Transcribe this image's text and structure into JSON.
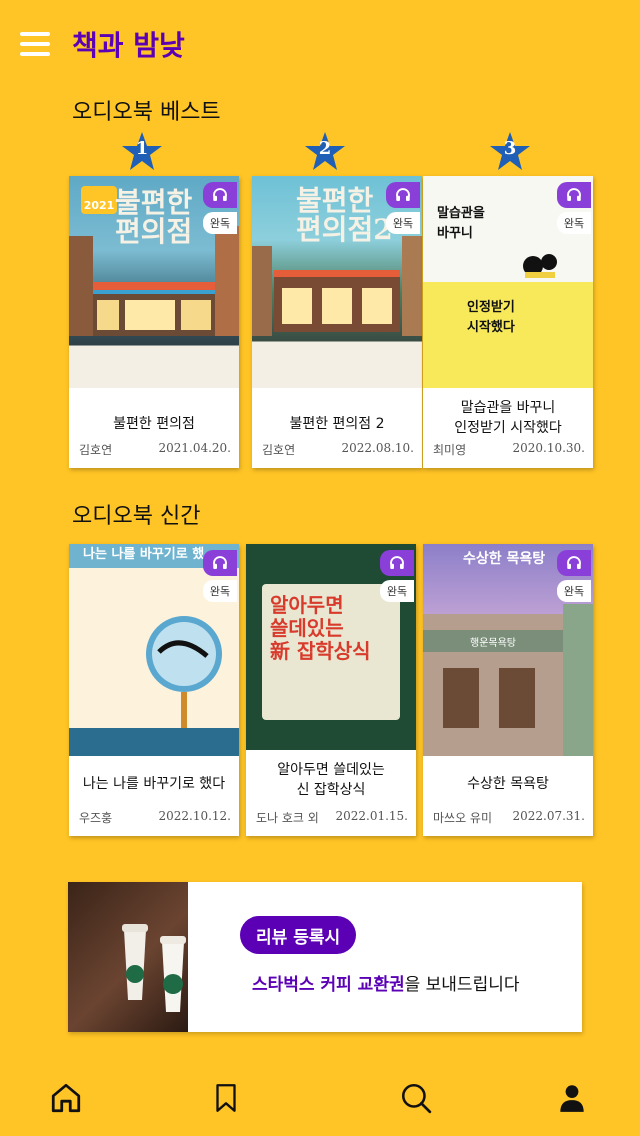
{
  "app": {
    "title": "책과 밤낮"
  },
  "sections": {
    "best": {
      "title": "오디오북 베스트"
    },
    "new": {
      "title": "오디오북 신간"
    }
  },
  "badges": {
    "done": "완독"
  },
  "best_books": [
    {
      "rank": "1",
      "title": "불편한 편의점",
      "author": "김호연",
      "date": "2021.04.20.",
      "cover_title": "불편한\n편의점",
      "cover_badge": "2021"
    },
    {
      "rank": "2",
      "title": "불편한 편의점 2",
      "author": "김호연",
      "date": "2022.08.10.",
      "cover_title": "불편한\n편의점2"
    },
    {
      "rank": "3",
      "title": "말습관을 바꾸니\n인정받기 시작했다",
      "author": "최미영",
      "date": "2020.10.30.",
      "cover_title_top": "말습관을\n바꾸니",
      "cover_title_bottom": "인정받기\n시작했다"
    }
  ],
  "new_books": [
    {
      "title": "나는 나를 바꾸기로 했다",
      "author": "우즈훙",
      "date": "2022.10.12.",
      "cover_title": "나는 나를 바꾸기로 했"
    },
    {
      "title": "알아두면 쓸데있는\n신 잡학상식",
      "author": "도나 호크 외",
      "date": "2022.01.15.",
      "cover_title": "알아두면\n쓸데있는\n新 잡학상식"
    },
    {
      "title": "수상한 목욕탕",
      "author": "마쓰오 유미",
      "date": "2022.07.31.",
      "cover_title": "수상한 목욕탕",
      "cover_sign": "행운목욕탕"
    }
  ],
  "banner": {
    "pill": "리뷰 등록시",
    "highlight": "스타벅스 커피 교환권",
    "rest": "을 보내드립니다"
  },
  "colors": {
    "background": "#FFC425",
    "accent": "#5B00B5",
    "headphone": "#8B3FD9",
    "star": "#1F5FB5"
  },
  "nav": [
    {
      "icon": "home-icon"
    },
    {
      "icon": "bookmark-icon"
    },
    {
      "icon": "search-icon"
    },
    {
      "icon": "profile-icon"
    }
  ]
}
